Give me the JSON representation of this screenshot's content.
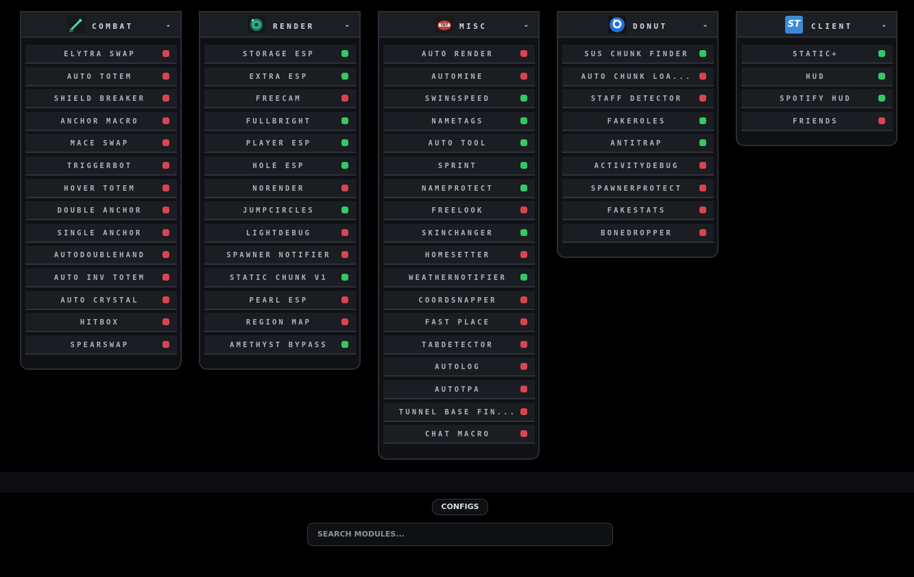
{
  "panels": [
    {
      "title": "COMBAT",
      "collapse": "-",
      "icon": "sword-icon",
      "modules": [
        {
          "name": "ELYTRA SWAP",
          "enabled": false
        },
        {
          "name": "AUTO TOTEM",
          "enabled": false
        },
        {
          "name": "SHIELD BREAKER",
          "enabled": false
        },
        {
          "name": "ANCHOR MACRO",
          "enabled": false
        },
        {
          "name": "MACE SWAP",
          "enabled": false
        },
        {
          "name": "TRIGGERBOT",
          "enabled": false
        },
        {
          "name": "HOVER TOTEM",
          "enabled": false
        },
        {
          "name": "DOUBLE ANCHOR",
          "enabled": false
        },
        {
          "name": "SINGLE ANCHOR",
          "enabled": false
        },
        {
          "name": "AUTODOUBLEHAND",
          "enabled": false
        },
        {
          "name": "AUTO INV TOTEM",
          "enabled": false
        },
        {
          "name": "AUTO CRYSTAL",
          "enabled": false
        },
        {
          "name": "HITBOX",
          "enabled": false
        },
        {
          "name": "SPEARSWAP",
          "enabled": false
        }
      ]
    },
    {
      "title": "RENDER",
      "collapse": "-",
      "icon": "ender-eye-icon",
      "modules": [
        {
          "name": "STORAGE ESP",
          "enabled": true
        },
        {
          "name": "EXTRA ESP",
          "enabled": true
        },
        {
          "name": "FREECAM",
          "enabled": false
        },
        {
          "name": "FULLBRIGHT",
          "enabled": true
        },
        {
          "name": "PLAYER ESP",
          "enabled": true
        },
        {
          "name": "HOLE ESP",
          "enabled": true
        },
        {
          "name": "NORENDER",
          "enabled": false
        },
        {
          "name": "JUMPCIRCLES",
          "enabled": true
        },
        {
          "name": "LIGHTDEBUG",
          "enabled": false
        },
        {
          "name": "SPAWNER NOTIFIER",
          "enabled": false
        },
        {
          "name": "STATIC CHUNK V1",
          "enabled": true
        },
        {
          "name": "PEARL ESP",
          "enabled": false
        },
        {
          "name": "REGION MAP",
          "enabled": false
        },
        {
          "name": "AMETHYST BYPASS",
          "enabled": true
        }
      ]
    },
    {
      "title": "MISC",
      "collapse": "-",
      "icon": "tnt-icon",
      "modules": [
        {
          "name": "AUTO RENDER",
          "enabled": false
        },
        {
          "name": "AUTOMINE",
          "enabled": false
        },
        {
          "name": "SWINGSPEED",
          "enabled": true
        },
        {
          "name": "NAMETAGS",
          "enabled": true
        },
        {
          "name": "AUTO TOOL",
          "enabled": true
        },
        {
          "name": "SPRINT",
          "enabled": true
        },
        {
          "name": "NAMEPROTECT",
          "enabled": true
        },
        {
          "name": "FREELOOK",
          "enabled": false
        },
        {
          "name": "SKINCHANGER",
          "enabled": true
        },
        {
          "name": "HOMESETTER",
          "enabled": false
        },
        {
          "name": "WEATHERNOTIFIER",
          "enabled": true
        },
        {
          "name": "COORDSNAPPER",
          "enabled": false
        },
        {
          "name": "FAST PLACE",
          "enabled": false
        },
        {
          "name": "TABDETECTOR",
          "enabled": false
        },
        {
          "name": "AUTOLOG",
          "enabled": false
        },
        {
          "name": "AUTOTPA",
          "enabled": false
        },
        {
          "name": "TUNNEL BASE FIN...",
          "enabled": false
        },
        {
          "name": "CHAT MACRO",
          "enabled": false
        }
      ]
    },
    {
      "title": "DONUT",
      "collapse": "-",
      "icon": "donut-icon",
      "modules": [
        {
          "name": "SUS CHUNK FINDER",
          "enabled": true
        },
        {
          "name": "AUTO CHUNK LOA...",
          "enabled": false
        },
        {
          "name": "STAFF DETECTOR",
          "enabled": false
        },
        {
          "name": "FAKEROLES",
          "enabled": true
        },
        {
          "name": "ANTITRAP",
          "enabled": true
        },
        {
          "name": "ACTIVITYDEBUG",
          "enabled": false
        },
        {
          "name": "SPAWNERPROTECT",
          "enabled": false
        },
        {
          "name": "FAKESTATS",
          "enabled": false
        },
        {
          "name": "BONEDROPPER",
          "enabled": false
        }
      ]
    },
    {
      "title": "CLIENT",
      "collapse": "-",
      "icon": "client-logo-icon",
      "icon_text": "ST",
      "modules": [
        {
          "name": "STATIC+",
          "enabled": true
        },
        {
          "name": "HUD",
          "enabled": true
        },
        {
          "name": "SPOTIFY HUD",
          "enabled": true
        },
        {
          "name": "FRIENDS",
          "enabled": false
        }
      ]
    }
  ],
  "footer": {
    "configs_label": "CONFIGS",
    "search_placeholder": "SEARCH MODULES..."
  },
  "colors": {
    "enabled": "#35c864",
    "disabled": "#d94452",
    "background": "#000000",
    "panel": "#0f1114",
    "module": "#1a1d21"
  }
}
